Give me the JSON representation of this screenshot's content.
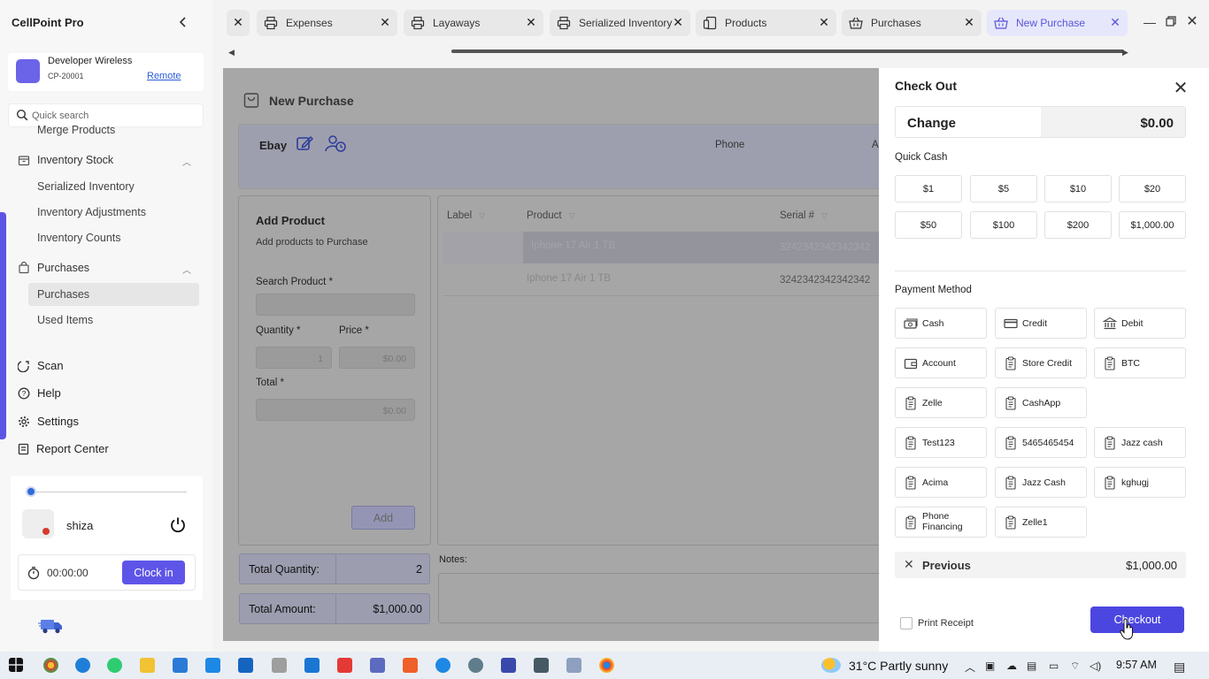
{
  "app": {
    "title": "CellPoint Pro"
  },
  "store": {
    "name": "Developer Wireless",
    "id": "CP-20001",
    "remote_label": "Remote"
  },
  "search": {
    "placeholder": "Quick search"
  },
  "nav": {
    "merge_products": "Merge Products",
    "inventory_stock": "Inventory Stock",
    "serialized_inventory": "Serialized Inventory",
    "inventory_adjustments": "Inventory Adjustments",
    "inventory_counts": "Inventory Counts",
    "purchases_group": "Purchases",
    "purchases": "Purchases",
    "used_items": "Used Items",
    "scan": "Scan",
    "help": "Help",
    "settings": "Settings",
    "report_center": "Report Center"
  },
  "user": {
    "name": "shiza",
    "timer": "00:00:00",
    "clock_in_label": "Clock in"
  },
  "tabs": [
    {
      "label": "Expenses",
      "icon": "printer-icon"
    },
    {
      "label": "Layaways",
      "icon": "printer-icon"
    },
    {
      "label": "Serialized Inventory",
      "icon": "printer-icon"
    },
    {
      "label": "Products",
      "icon": "device-icon"
    },
    {
      "label": "Purchases",
      "icon": "basket-icon"
    },
    {
      "label": "New Purchase",
      "icon": "basket-icon",
      "active": true
    }
  ],
  "purchase": {
    "title": "New Purchase",
    "vendor": "Ebay",
    "phone_label": "Phone",
    "truncated_label": "A",
    "add_product": {
      "title": "Add Product",
      "subtitle": "Add products to Purchase",
      "search_label": "Search Product *",
      "quantity_label": "Quantity *",
      "quantity_value": "1",
      "price_label": "Price *",
      "price_value": "$0.00",
      "total_label": "Total *",
      "total_value": "$0.00",
      "add_label": "Add"
    },
    "grid": {
      "headers": [
        "Label",
        "Product",
        "Serial #"
      ],
      "rows": [
        {
          "label": "",
          "product": "Iphone 17 Air 1 TB",
          "serial": "3242342342342342"
        },
        {
          "label": "",
          "product": "Iphone 17 Air 1 TB",
          "serial": "3242342342342342"
        }
      ]
    },
    "total_quantity_label": "Total Quantity:",
    "total_quantity": "2",
    "total_amount_label": "Total Amount:",
    "total_amount": "$1,000.00",
    "notes_label": "Notes:"
  },
  "checkout": {
    "title": "Check Out",
    "change_label": "Change",
    "change_value": "$0.00",
    "quick_cash_label": "Quick Cash",
    "quick_cash": [
      "$1",
      "$5",
      "$10",
      "$20",
      "$50",
      "$100",
      "$200",
      "$1,000.00"
    ],
    "payment_method_label": "Payment Method",
    "payment_methods": [
      {
        "label": "Cash",
        "icon": "cash-icon"
      },
      {
        "label": "Credit",
        "icon": "credit-card-icon"
      },
      {
        "label": "Debit",
        "icon": "bank-icon"
      },
      {
        "label": "Account",
        "icon": "wallet-icon"
      },
      {
        "label": "Store Credit",
        "icon": "clipboard-icon"
      },
      {
        "label": "BTC",
        "icon": "clipboard-icon"
      },
      {
        "label": "Zelle",
        "icon": "clipboard-icon"
      },
      {
        "label": "CashApp",
        "icon": "clipboard-icon"
      },
      {
        "label": "Test123",
        "icon": "clipboard-icon"
      },
      {
        "label": "5465465454",
        "icon": "clipboard-icon"
      },
      {
        "label": "Jazz cash",
        "icon": "clipboard-icon"
      },
      {
        "label": "Acima",
        "icon": "clipboard-icon"
      },
      {
        "label": "Jazz Cash",
        "icon": "clipboard-icon"
      },
      {
        "label": "kghugj",
        "icon": "clipboard-icon"
      },
      {
        "label": "Phone Financing",
        "icon": "clipboard-icon"
      },
      {
        "label": "Zelle1",
        "icon": "clipboard-icon"
      }
    ],
    "previous_label": "Previous",
    "previous_value": "$1,000.00",
    "print_receipt_label": "Print Receipt",
    "checkout_label": "Checkout"
  },
  "taskbar": {
    "weather": "31°C  Partly sunny",
    "time": "9:57 AM"
  },
  "colors": {
    "accent": "#5e55e8",
    "checkout_button": "#4c46e0",
    "active_tab_text": "#5a55d8"
  }
}
